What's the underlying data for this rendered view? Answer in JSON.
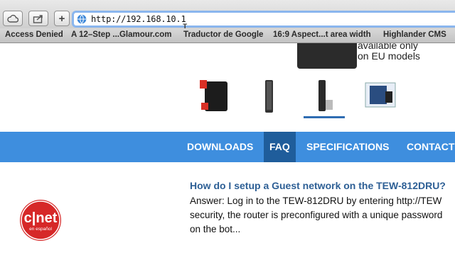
{
  "browser": {
    "url": "http://192.168.10.1",
    "bookmarks": [
      "Access Denied",
      "A 12–Step ...Glamour.com",
      "Traductor de Google",
      "16:9 Aspect...t area width",
      "Highlander CMS"
    ]
  },
  "page": {
    "promo_text": [
      "available only",
      "on EU models"
    ],
    "nav": {
      "downloads": "DOWNLOADS",
      "faq": "FAQ",
      "specifications": "SPECIFICATIONS",
      "contact": "CONTACT"
    },
    "faq_question": "How do I setup a Guest network on the TEW-812DRU?",
    "faq_answer_lines": [
      "Answer: Log in to the TEW-812DRU by entering http://TEW",
      "security, the router is preconfigured with a unique password",
      "on the bot..."
    ],
    "nav_color": "#3e8ede",
    "nav_active_color": "#1f5d9b",
    "link_color": "#2d5f95"
  },
  "watermark": {
    "logo_text": "cnet",
    "logo_subtext": "en español",
    "color": "#d62828"
  }
}
